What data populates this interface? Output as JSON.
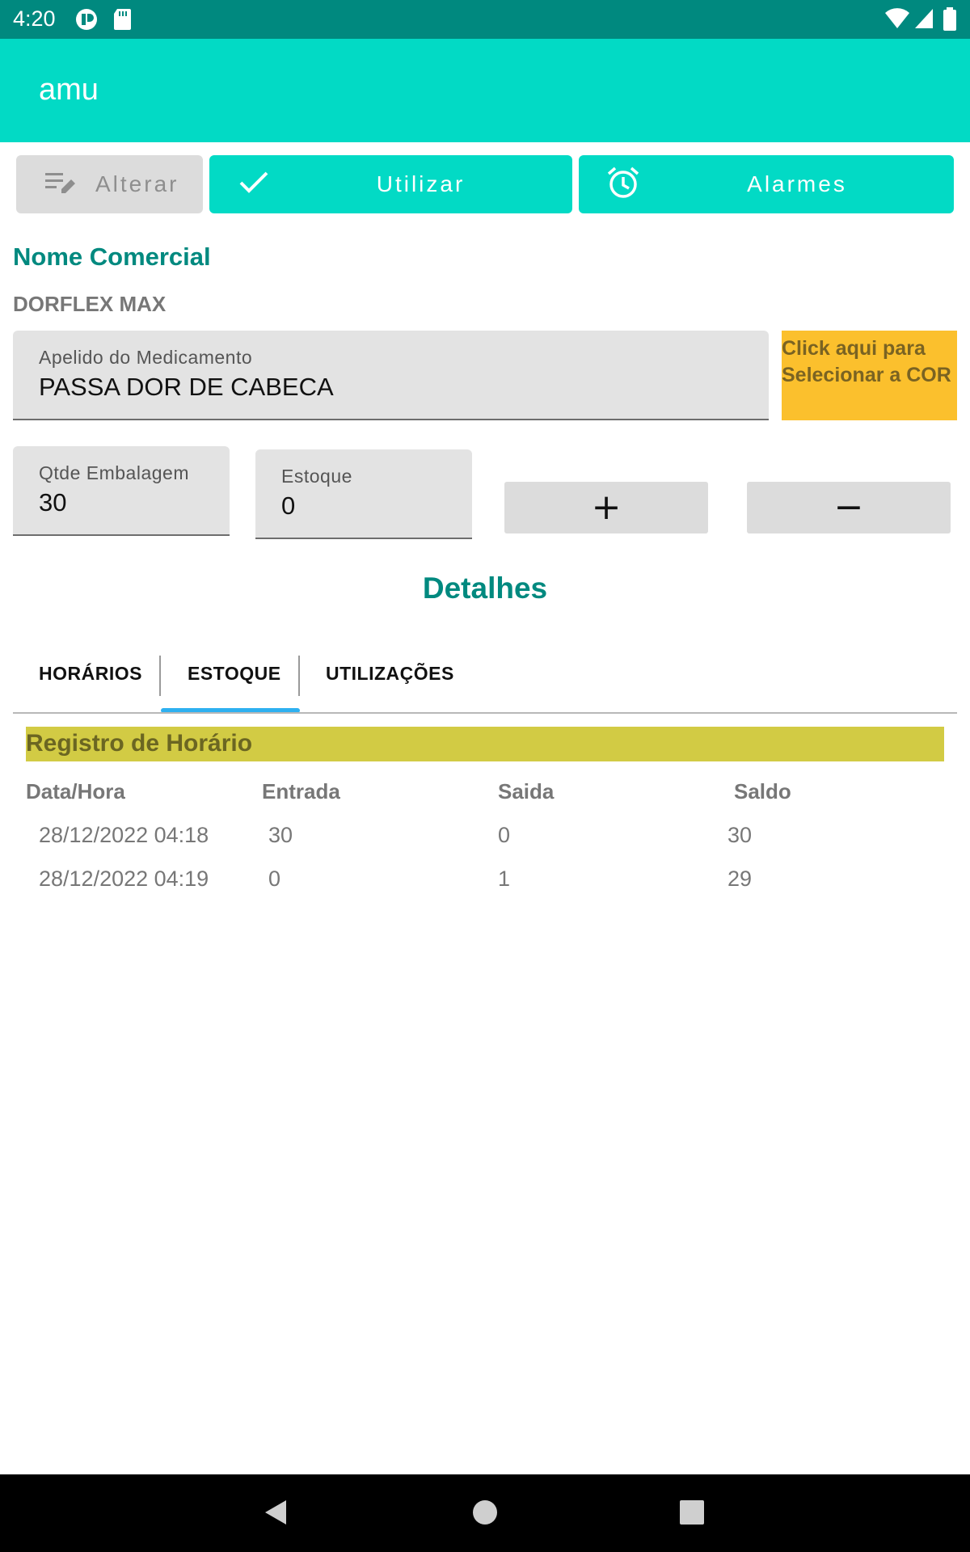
{
  "status_bar": {
    "time": "4:20"
  },
  "app_bar": {
    "title": "amu"
  },
  "toolbar": {
    "alterar_label": "Alterar",
    "utilizar_label": "Utilizar",
    "alarmes_label": "Alarmes"
  },
  "product": {
    "section_title": "Nome Comercial",
    "commercial_name": "DORFLEX MAX"
  },
  "nickname_field": {
    "label": "Apelido do Medicamento",
    "value": "PASSA DOR DE CABECA"
  },
  "color_button": {
    "line1": "Click aqui para",
    "line2": "Selecionar a COR",
    "color": "#fbc02d"
  },
  "package_field": {
    "label": "Qtde Embalagem",
    "value": "30"
  },
  "stock_field": {
    "label": "Estoque",
    "value": "0"
  },
  "stepper": {
    "plus": "+",
    "minus": "−"
  },
  "details": {
    "title": "Detalhes"
  },
  "tabs": [
    {
      "label": "HORÁRIOS",
      "selected": false
    },
    {
      "label": "ESTOQUE",
      "selected": true
    },
    {
      "label": "UTILIZAÇÕES",
      "selected": false
    }
  ],
  "register": {
    "title": "Registro de Horário",
    "columns": [
      "Data/Hora",
      "Entrada",
      "Saida",
      "Saldo"
    ],
    "rows": [
      [
        "28/12/2022 04:18",
        "30",
        "0",
        "30"
      ],
      [
        "28/12/2022 04:19",
        "0",
        "1",
        "29"
      ]
    ]
  },
  "colors": {
    "primary": "#02dac5",
    "primary_dark": "#00897f",
    "tab_indicator": "#2eb0f0",
    "register_header_bg": "#d2cb44"
  }
}
